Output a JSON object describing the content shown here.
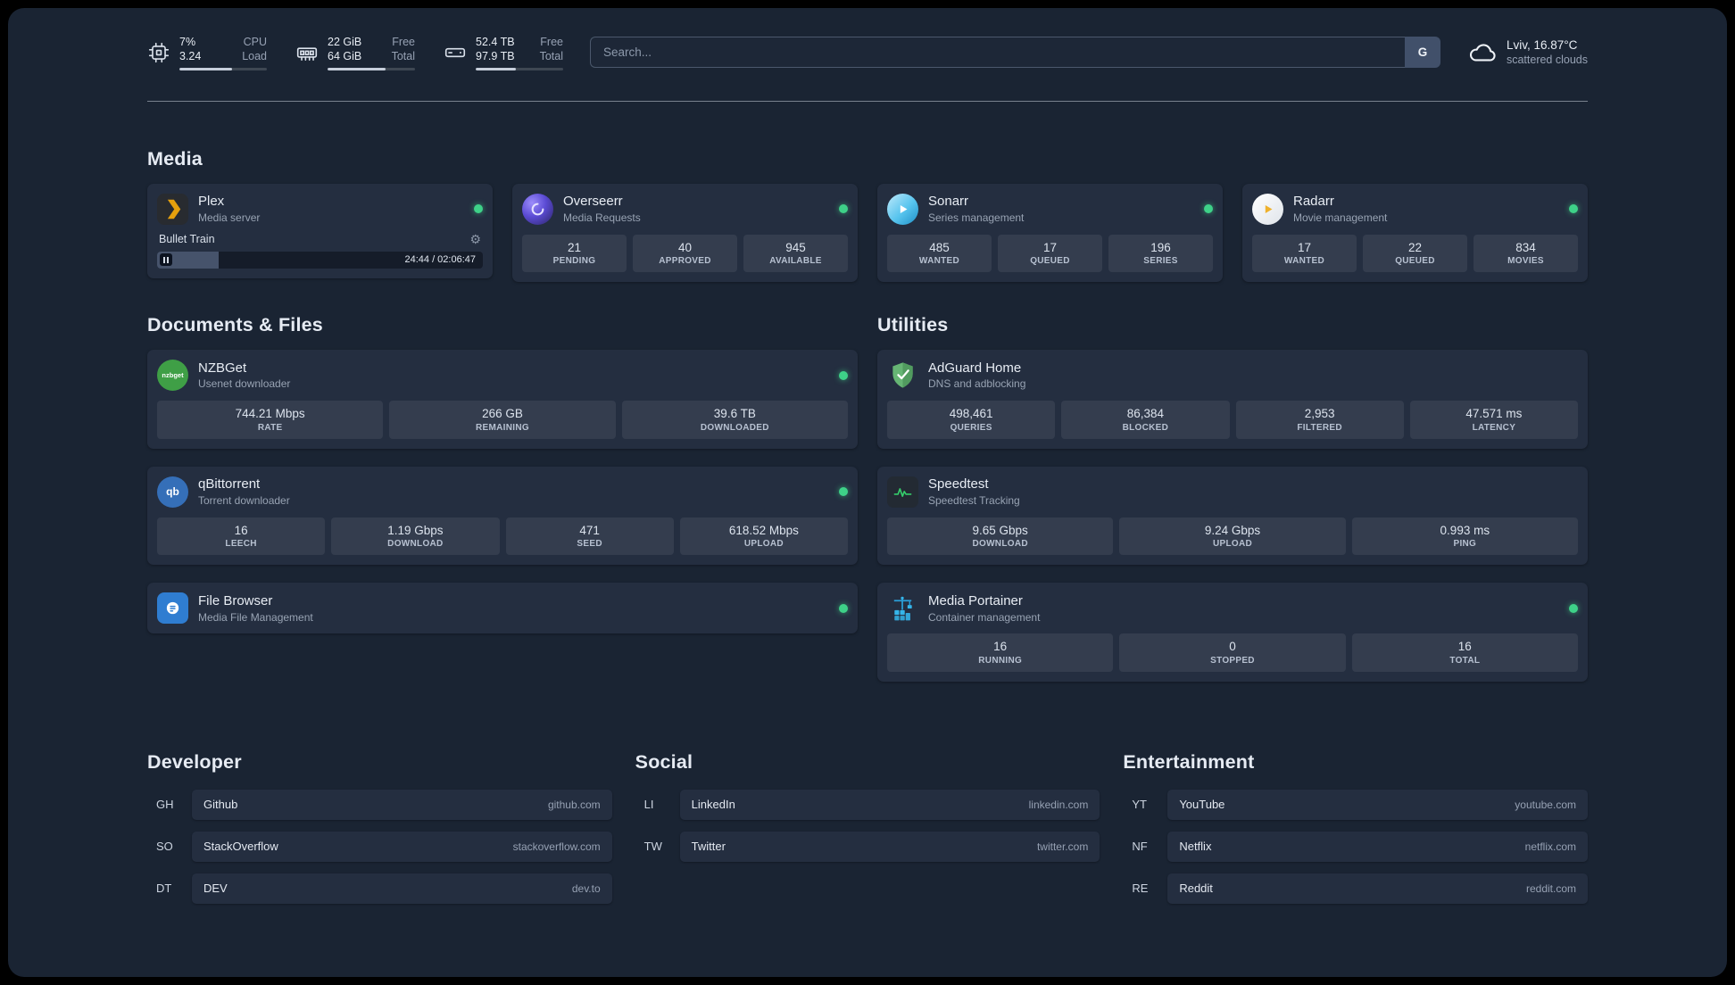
{
  "topbar": {
    "resources": [
      {
        "id": "cpu",
        "rows": [
          {
            "value": "7%",
            "label": "CPU"
          },
          {
            "value": "3.24",
            "label": "Load"
          }
        ],
        "progress": 60
      },
      {
        "id": "memory",
        "rows": [
          {
            "value": "22 GiB",
            "label": "Free"
          },
          {
            "value": "64 GiB",
            "label": "Total"
          }
        ],
        "progress": 66
      },
      {
        "id": "disk",
        "rows": [
          {
            "value": "52.4 TB",
            "label": "Free"
          },
          {
            "value": "97.9 TB",
            "label": "Total"
          }
        ],
        "progress": 46
      }
    ],
    "search": {
      "placeholder": "Search...",
      "provider_label": "G"
    },
    "weather": {
      "location": "Lviv, 16.87°C",
      "condition": "scattered clouds"
    }
  },
  "groups": [
    {
      "title": "Media",
      "cards": [
        {
          "id": "plex",
          "name": "Plex",
          "description": "Media server",
          "status": true,
          "player": {
            "track": "Bullet Train",
            "time": "24:44 / 02:06:47",
            "progress": 19
          }
        },
        {
          "id": "overseerr",
          "name": "Overseerr",
          "description": "Media Requests",
          "status": true,
          "stats": [
            {
              "value": "21",
              "label": "PENDING"
            },
            {
              "value": "40",
              "label": "APPROVED"
            },
            {
              "value": "945",
              "label": "AVAILABLE"
            }
          ]
        },
        {
          "id": "sonarr",
          "name": "Sonarr",
          "description": "Series management",
          "status": true,
          "stats": [
            {
              "value": "485",
              "label": "WANTED"
            },
            {
              "value": "17",
              "label": "QUEUED"
            },
            {
              "value": "196",
              "label": "SERIES"
            }
          ]
        },
        {
          "id": "radarr",
          "name": "Radarr",
          "description": "Movie management",
          "status": true,
          "stats": [
            {
              "value": "17",
              "label": "WANTED"
            },
            {
              "value": "22",
              "label": "QUEUED"
            },
            {
              "value": "834",
              "label": "MOVIES"
            }
          ]
        }
      ]
    },
    {
      "title": "Documents & Files",
      "cards": [
        {
          "id": "nzbget",
          "name": "NZBGet",
          "description": "Usenet downloader",
          "status": true,
          "stats": [
            {
              "value": "744.21 Mbps",
              "label": "RATE"
            },
            {
              "value": "266 GB",
              "label": "REMAINING"
            },
            {
              "value": "39.6 TB",
              "label": "DOWNLOADED"
            }
          ]
        },
        {
          "id": "qbittorrent",
          "name": "qBittorrent",
          "description": "Torrent downloader",
          "status": true,
          "stats": [
            {
              "value": "16",
              "label": "LEECH"
            },
            {
              "value": "1.19 Gbps",
              "label": "DOWNLOAD"
            },
            {
              "value": "471",
              "label": "SEED"
            },
            {
              "value": "618.52 Mbps",
              "label": "UPLOAD"
            }
          ]
        },
        {
          "id": "filebrowser",
          "name": "File Browser",
          "description": "Media File Management",
          "status": true
        }
      ]
    },
    {
      "title": "Utilities",
      "cards": [
        {
          "id": "adguard",
          "name": "AdGuard Home",
          "description": "DNS and adblocking",
          "status": false,
          "stats": [
            {
              "value": "498,461",
              "label": "QUERIES"
            },
            {
              "value": "86,384",
              "label": "BLOCKED"
            },
            {
              "value": "2,953",
              "label": "FILTERED"
            },
            {
              "value": "47.571 ms",
              "label": "LATENCY"
            }
          ]
        },
        {
          "id": "speedtest",
          "name": "Speedtest",
          "description": "Speedtest Tracking",
          "status": false,
          "stats": [
            {
              "value": "9.65 Gbps",
              "label": "DOWNLOAD"
            },
            {
              "value": "9.24 Gbps",
              "label": "UPLOAD"
            },
            {
              "value": "0.993 ms",
              "label": "PING"
            }
          ]
        },
        {
          "id": "portainer",
          "name": "Media Portainer",
          "description": "Container management",
          "status": true,
          "stats": [
            {
              "value": "16",
              "label": "RUNNING"
            },
            {
              "value": "0",
              "label": "STOPPED"
            },
            {
              "value": "16",
              "label": "TOTAL"
            }
          ]
        }
      ]
    }
  ],
  "bookmarks": [
    {
      "title": "Developer",
      "items": [
        {
          "abbr": "GH",
          "name": "Github",
          "url": "github.com"
        },
        {
          "abbr": "SO",
          "name": "StackOverflow",
          "url": "stackoverflow.com"
        },
        {
          "abbr": "DT",
          "name": "DEV",
          "url": "dev.to"
        }
      ]
    },
    {
      "title": "Social",
      "items": [
        {
          "abbr": "LI",
          "name": "LinkedIn",
          "url": "linkedin.com"
        },
        {
          "abbr": "TW",
          "name": "Twitter",
          "url": "twitter.com"
        }
      ]
    },
    {
      "title": "Entertainment",
      "items": [
        {
          "abbr": "YT",
          "name": "YouTube",
          "url": "youtube.com"
        },
        {
          "abbr": "NF",
          "name": "Netflix",
          "url": "netflix.com"
        },
        {
          "abbr": "RE",
          "name": "Reddit",
          "url": "reddit.com"
        }
      ]
    }
  ],
  "colors": {
    "status_online": "#3ed188",
    "accent_progress": "#c6cedb",
    "background": "#1a2433",
    "card": "#242e40"
  }
}
